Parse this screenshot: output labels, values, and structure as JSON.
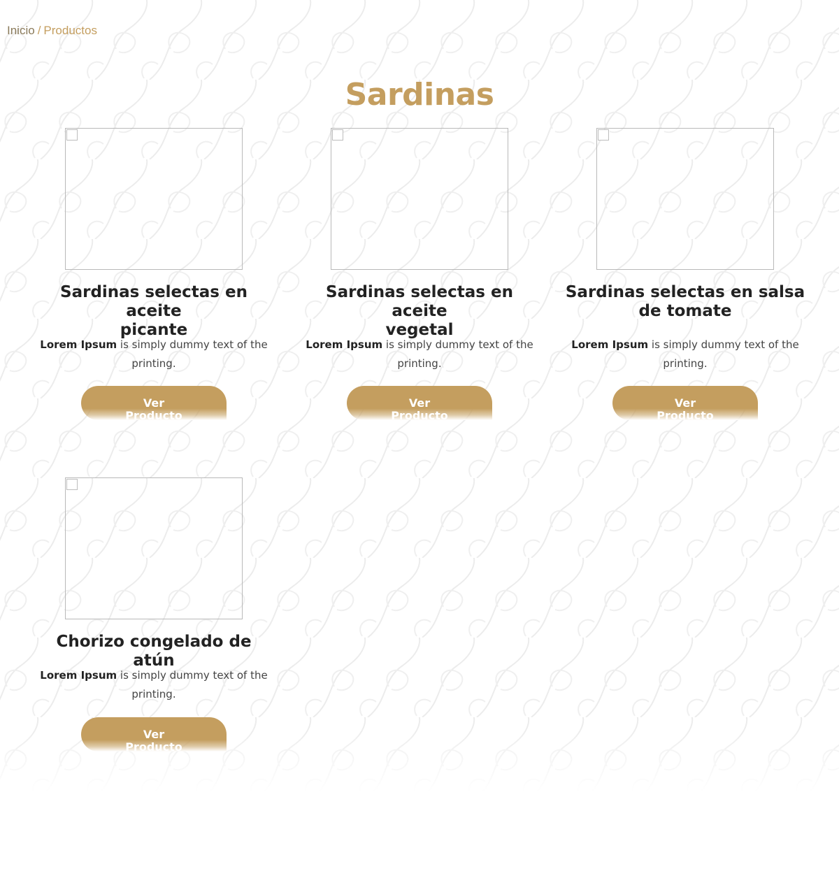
{
  "breadcrumb": {
    "home": "Inicio",
    "separator": "/",
    "current": "Productos"
  },
  "page_title": "Sardinas",
  "colors": {
    "accent": "#c49e5f",
    "heading_text": "#222222",
    "body_text": "#444444",
    "breadcrumb_home": "#8a7a5a"
  },
  "products": [
    {
      "title_line1": "Sardinas selectas en aceite",
      "title_line2": "picante",
      "desc_bold": "Lorem Ipsum",
      "desc_rest": "is simply dummy text of the",
      "desc_line2": "printing.",
      "button_line1": "Ver",
      "button_line2": "Producto"
    },
    {
      "title_line1": "Sardinas selectas en aceite",
      "title_line2": "vegetal",
      "desc_bold": "Lorem Ipsum",
      "desc_rest": "is simply dummy text of the",
      "desc_line2": "printing.",
      "button_line1": "Ver",
      "button_line2": "Producto"
    },
    {
      "title_line1": "Sardinas selectas en salsa",
      "title_line2": "de tomate",
      "desc_bold": "Lorem Ipsum",
      "desc_rest": "is simply dummy text of the",
      "desc_line2": "printing.",
      "button_line1": "Ver",
      "button_line2": "Producto"
    },
    {
      "title_line1": "Chorizo congelado de atún",
      "title_line2": "",
      "desc_bold": "Lorem Ipsum",
      "desc_rest": "is simply dummy text of the",
      "desc_line2": "printing.",
      "button_line1": "Ver",
      "button_line2": "Producto"
    }
  ]
}
